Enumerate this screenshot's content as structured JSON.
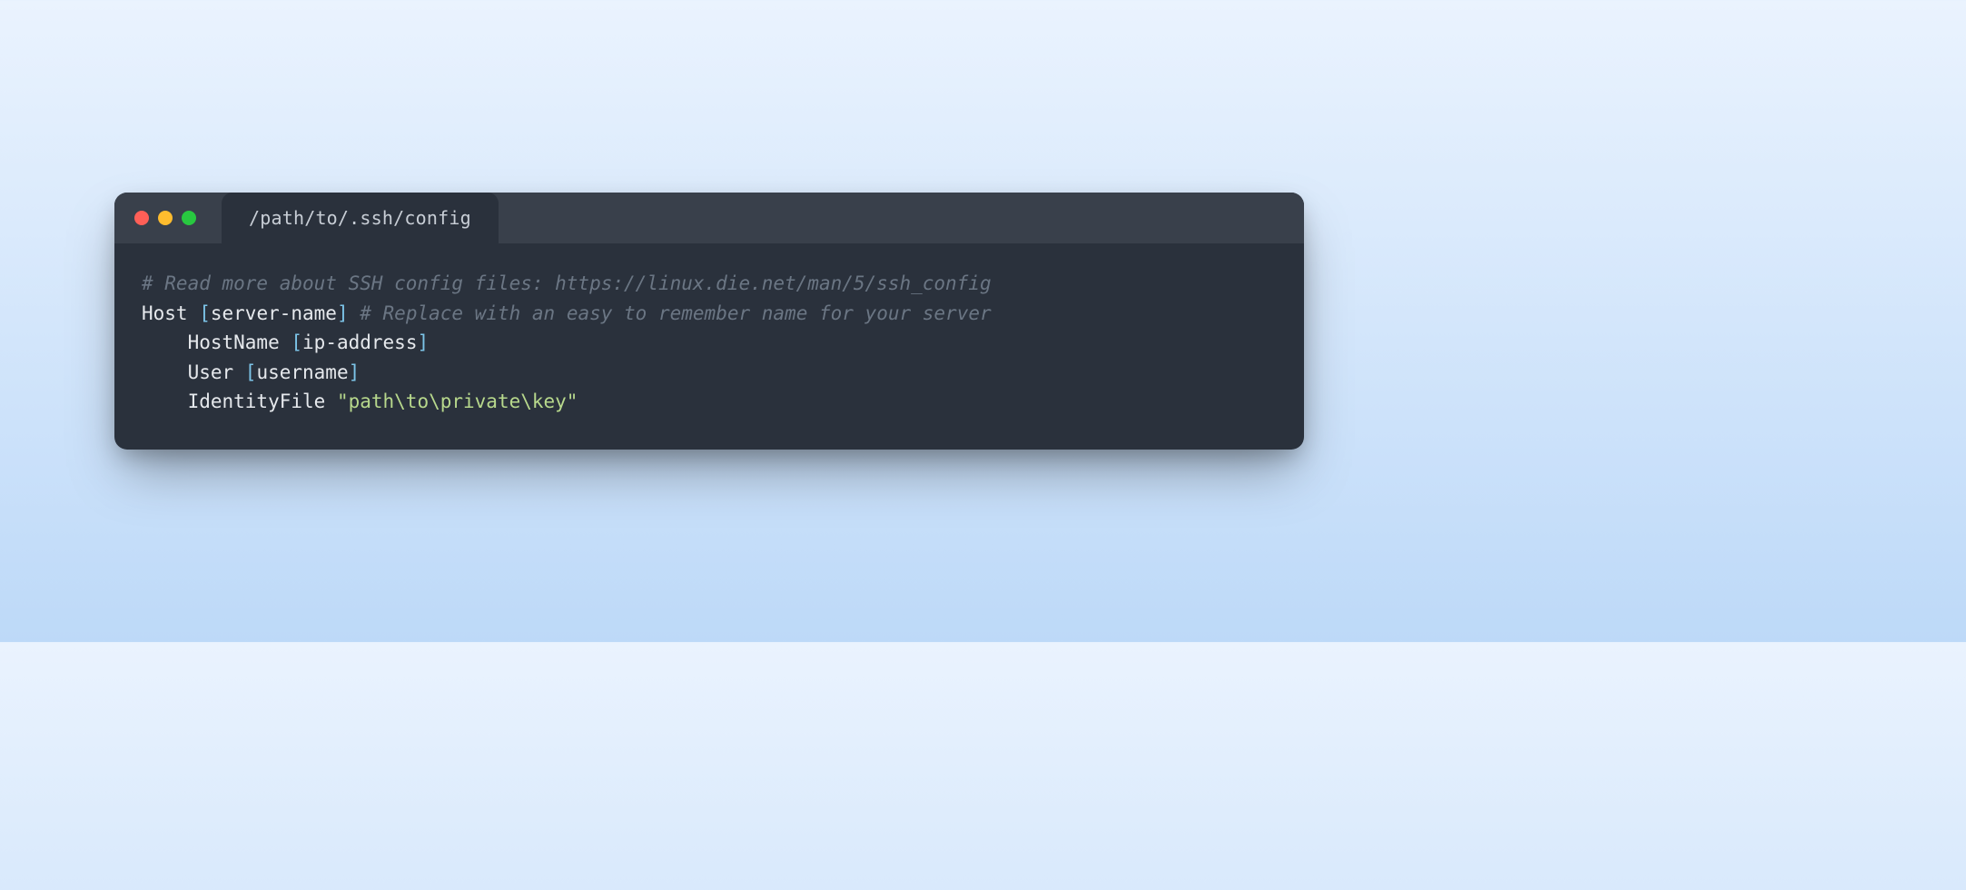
{
  "tab": {
    "title": "/path/to/.ssh/config"
  },
  "code": {
    "line1_comment": "# Read more about SSH config files: https://linux.die.net/man/5/ssh_config",
    "line2_host": "Host ",
    "line2_br_open": "[",
    "line2_name": "server-name",
    "line2_br_close": "]",
    "line2_comment": " # Replace with an easy to remember name for your server",
    "line3_indent": "    HostName ",
    "line3_br_open": "[",
    "line3_val": "ip-address",
    "line3_br_close": "]",
    "line4_indent": "    User ",
    "line4_br_open": "[",
    "line4_val": "username",
    "line4_br_close": "]",
    "line5_indent": "    IdentityFile ",
    "line5_string": "\"path\\to\\private\\key\""
  }
}
